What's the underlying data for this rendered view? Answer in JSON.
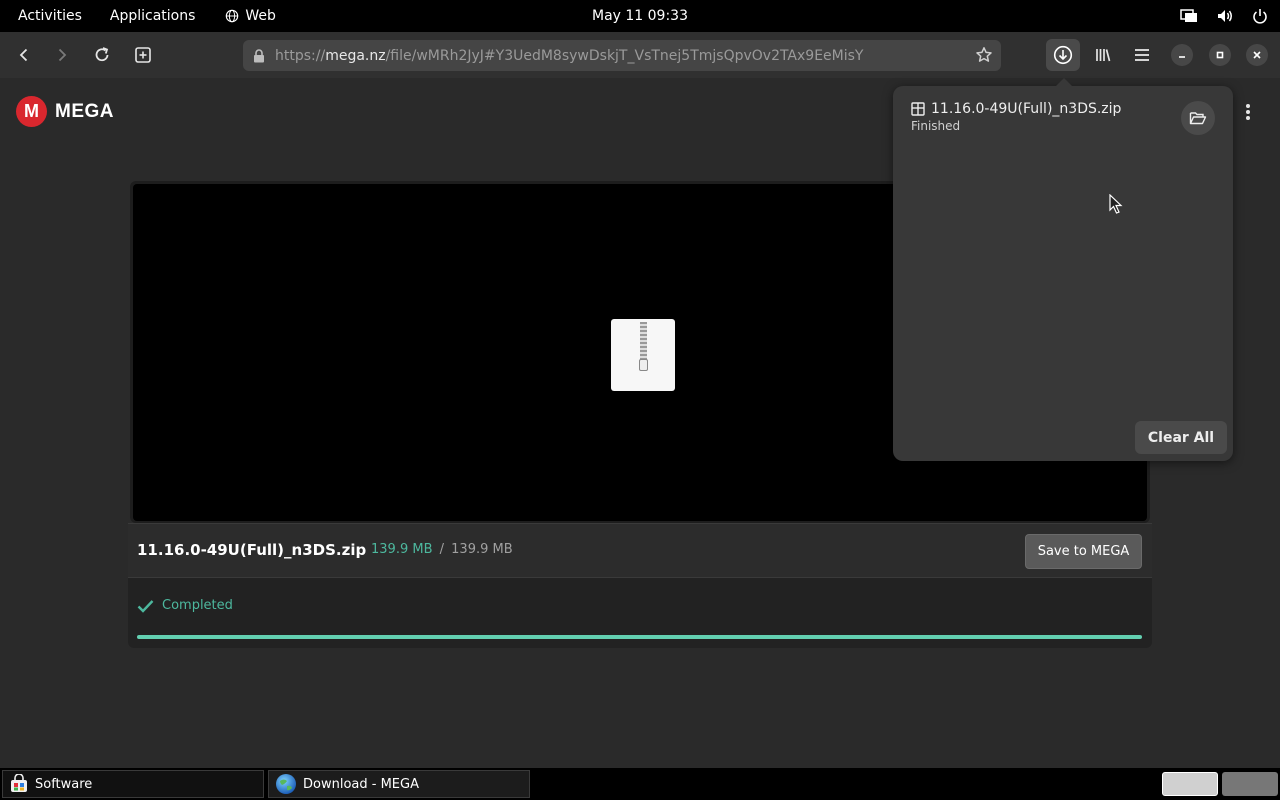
{
  "topbar": {
    "activities": "Activities",
    "applications": "Applications",
    "web": "Web",
    "clock": "May 11  09:33"
  },
  "browser": {
    "url_prefix": "https://",
    "url_host": "mega.nz",
    "url_path": "/file/wMRh2JyJ#Y3UedM8sywDskjT_VsTnej5TmjsQpvOv2TAx9EeMisY"
  },
  "page": {
    "logo_letter": "M",
    "logo_word": "MEGA",
    "file_name": "11.16.0-49U(Full)_n3DS.zip",
    "downloaded": "139.9 MB",
    "separator": "/",
    "total": "139.9 MB",
    "save_button": "Save to MEGA",
    "status": "Completed",
    "progress_fraction": 1.0
  },
  "downloads_popover": {
    "item_name": "11.16.0-49U(Full)_n3DS.zip",
    "item_status": "Finished",
    "clear_all": "Clear All"
  },
  "taskbar": {
    "tasks": [
      {
        "label": "Software",
        "icon": "software-icon"
      },
      {
        "label": "Download - MEGA",
        "icon": "web-browser-icon"
      }
    ]
  },
  "colors": {
    "mega_red": "#d9272e",
    "success_green": "#4db89e",
    "progress": "#63d0b1"
  }
}
